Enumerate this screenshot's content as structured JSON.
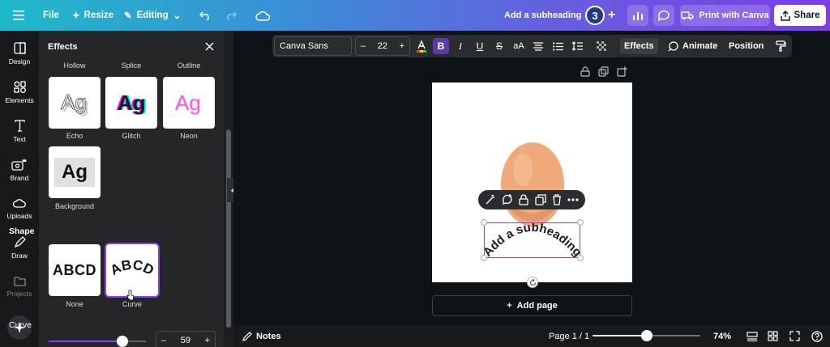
{
  "topbar": {
    "file_label": "File",
    "resize_label": "Resize",
    "editing_label": "Editing",
    "doc_title": "Add a subheading",
    "collaborator_count": "3",
    "print_label": "Print with Canva",
    "share_label": "Share"
  },
  "rail": {
    "items": [
      {
        "label": "Design"
      },
      {
        "label": "Elements"
      },
      {
        "label": "Text"
      },
      {
        "label": "Brand"
      },
      {
        "label": "Uploads"
      },
      {
        "label": "Draw"
      },
      {
        "label": "Projects"
      }
    ]
  },
  "panel": {
    "title": "Effects",
    "style_row1_captions": [
      "Hollow",
      "Splice",
      "Outline"
    ],
    "styles": [
      {
        "name": "Echo",
        "sample": "Ag"
      },
      {
        "name": "Glitch",
        "sample": "Ag"
      },
      {
        "name": "Neon",
        "sample": "Ag"
      },
      {
        "name": "Background",
        "sample": "Ag"
      }
    ],
    "shape_title": "Shape",
    "shapes": [
      {
        "name": "None",
        "sample": "ABCD"
      },
      {
        "name": "Curve",
        "sample": "ABCD"
      }
    ],
    "curve_label": "Curve",
    "curve_value": "59",
    "curve_fraction": 0.76,
    "minus": "–",
    "plus": "+"
  },
  "format_bar": {
    "font_name": "Canva Sans",
    "font_size": "22",
    "minus": "–",
    "plus": "+",
    "effects_label": "Effects",
    "animate_label": "Animate",
    "position_label": "Position"
  },
  "canvas": {
    "text": "Add a subheading",
    "add_page_label": "Add page"
  },
  "bottombar": {
    "notes_label": "Notes",
    "page_indicator": "Page 1 / 1",
    "zoom_label": "74%",
    "zoom_fraction": 0.5
  },
  "colors": {
    "accent": "#8b3dff",
    "egg": "#efa97a"
  }
}
